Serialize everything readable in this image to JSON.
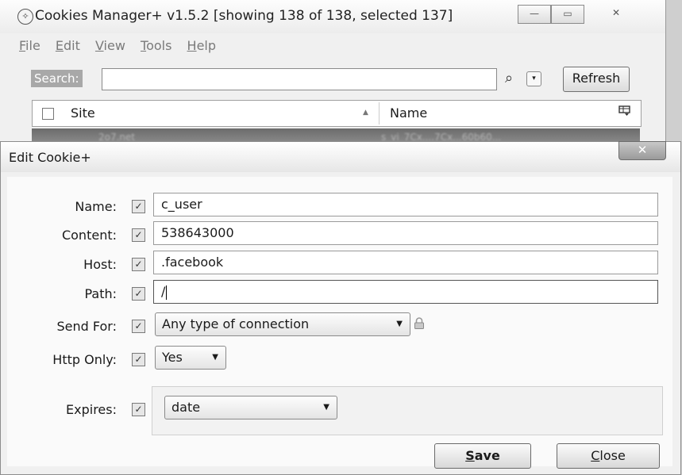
{
  "window": {
    "title": "Cookies Manager+ v1.5.2 [showing 138 of 138, selected 137]",
    "app_icon": "cookie-icon",
    "minimize_symbol": "—",
    "maximize_symbol": "▭",
    "close_symbol": "✕"
  },
  "menu": {
    "items": [
      {
        "first": "F",
        "rest": "ile"
      },
      {
        "first": "E",
        "rest": "dit"
      },
      {
        "first": "V",
        "rest": "iew"
      },
      {
        "first": "T",
        "rest": "ools"
      },
      {
        "first": "H",
        "rest": "elp"
      }
    ]
  },
  "search": {
    "label": "Search:",
    "value": "",
    "icon": "⌕",
    "dropdown_symbol": "▾",
    "refresh_label": "Refresh"
  },
  "list": {
    "columns": [
      "Site",
      "Name"
    ],
    "sort_indicator": "▲",
    "column_picker_icon": "column-picker-icon",
    "selected_row": {
      "site": "2o7.net",
      "name": "s_vi_7Cx....7Cx...60b60..."
    }
  },
  "dialog": {
    "title": "Edit Cookie+",
    "close_symbol": "✕",
    "check_mark": "✓",
    "fields": {
      "name": {
        "label": "Name:",
        "checked": true,
        "value": "c_user"
      },
      "content": {
        "label": "Content:",
        "checked": true,
        "value": "538643000"
      },
      "host": {
        "label": "Host:",
        "checked": true,
        "value": ".facebook"
      },
      "path": {
        "label": "Path:",
        "checked": true,
        "value": "/"
      }
    },
    "send_for": {
      "label": "Send For:",
      "checked": true,
      "value": "Any type of connection"
    },
    "http_only": {
      "label": "Http Only:",
      "checked": true,
      "value": "Yes"
    },
    "expires": {
      "label": "Expires:",
      "checked": true,
      "value": "date"
    },
    "save_label": {
      "first": "S",
      "rest": "ave"
    },
    "close_label": {
      "first": "C",
      "rest": "lose"
    },
    "dropdown_arrow": "▼"
  }
}
